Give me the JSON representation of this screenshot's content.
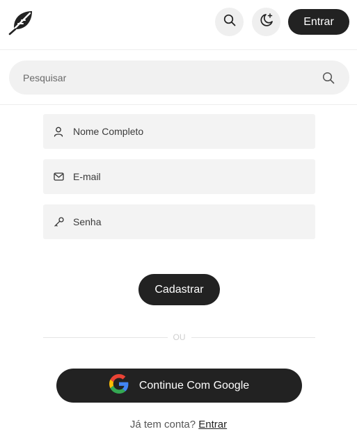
{
  "header": {
    "logo_icon": "feather-icon",
    "search_icon": "search-icon",
    "theme_icon": "moon-sparkle-icon",
    "login_label": "Entrar"
  },
  "search": {
    "placeholder": "Pesquisar",
    "icon": "search-icon"
  },
  "form": {
    "fields": [
      {
        "icon": "user-icon",
        "placeholder": "Nome Completo"
      },
      {
        "icon": "mail-icon",
        "placeholder": "E-mail"
      },
      {
        "icon": "key-icon",
        "placeholder": "Senha"
      }
    ],
    "submit_label": "Cadastrar",
    "divider_text": "OU",
    "google_label": "Continue Com Google",
    "google_icon": "google-icon"
  },
  "footer": {
    "prompt": "Já tem conta?",
    "link_label": "Entrar"
  },
  "colors": {
    "primary": "#222222",
    "field_bg": "#f3f3f3",
    "pill_bg": "#efefef"
  }
}
